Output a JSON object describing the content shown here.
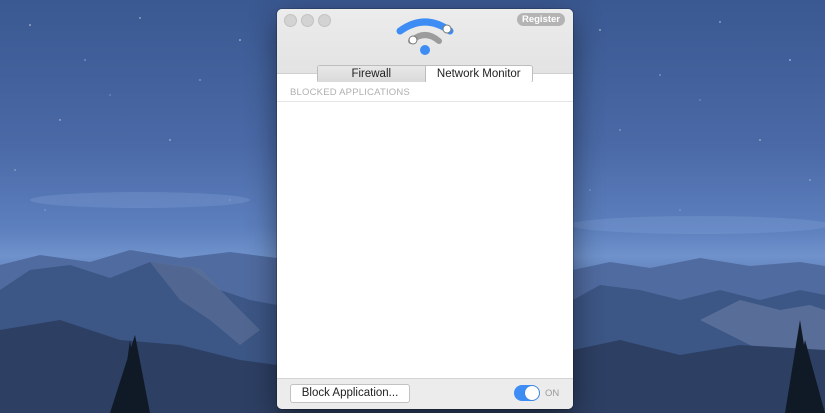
{
  "window": {
    "register_label": "Register"
  },
  "tabs": [
    {
      "label": "Firewall",
      "active": false
    },
    {
      "label": "Network Monitor",
      "active": true
    }
  ],
  "content": {
    "section_header": "BLOCKED APPLICATIONS",
    "items": []
  },
  "footer": {
    "block_button_label": "Block Application...",
    "toggle_state": "ON"
  },
  "colors": {
    "accent": "#3d8df5",
    "logo_grey": "#9c9c9c"
  },
  "icons": {
    "logo": "wifi-logo-icon",
    "traffic_lights": [
      "close-icon",
      "minimize-icon",
      "zoom-icon"
    ]
  }
}
